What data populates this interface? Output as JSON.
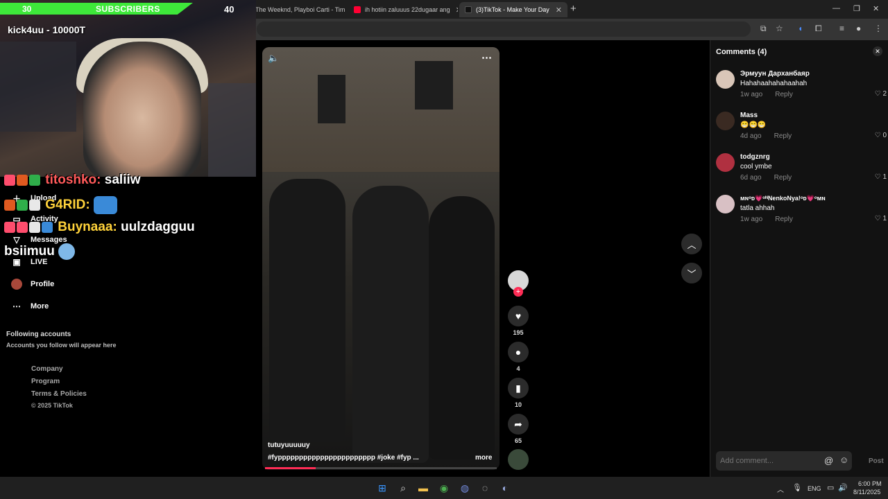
{
  "browser": {
    "tabs": [
      {
        "label": "The Weeknd, Playboi Carti - Tim",
        "fav_color": "#ff0033"
      },
      {
        "label": "ih hotiin zaluuus 22dugaar ang",
        "fav_color": "#ff0033"
      },
      {
        "label": "(3)TikTok - Make Your Day",
        "fav_color": "#111111"
      }
    ],
    "new_tab": "+"
  },
  "stream": {
    "sub_current": "30",
    "sub_label": "SUBSCRIBERS",
    "sub_goal": "40",
    "streamer_text": "kick4uu - 10000T"
  },
  "chat": [
    {
      "user": "titoshko:",
      "message": "saliiw",
      "user_color": "#ff5a5a"
    },
    {
      "user": "G4RID:",
      "message": "",
      "user_color": "#ffd23a"
    },
    {
      "user": "Buynaaa:",
      "message": "uulzdagguu",
      "user_color": "#ffd23a"
    },
    {
      "user": "",
      "message": "bsiimuu",
      "user_color": "#ffffff"
    }
  ],
  "sidebar": {
    "items": [
      {
        "label": "Upload",
        "icon": "plus-icon"
      },
      {
        "label": "Activity",
        "icon": "inbox-icon"
      },
      {
        "label": "Messages",
        "icon": "send-icon"
      },
      {
        "label": "LIVE",
        "icon": "live-icon"
      },
      {
        "label": "Profile",
        "icon": "avatar-icon"
      },
      {
        "label": "More",
        "icon": "more-icon"
      }
    ],
    "following_title": "Following accounts",
    "following_hint": "Accounts you follow will appear here",
    "footer": [
      "Company",
      "Program",
      "Terms & Policies",
      "© 2025 TikTok"
    ]
  },
  "video": {
    "author": "tutuyuuuuuy",
    "caption": "#fyppppppppppppppppppppppp  #joke  #fyp  ...",
    "more_label": "more",
    "progress": 0.22
  },
  "actions": {
    "likes": "195",
    "comments": "4",
    "saves": "10",
    "shares": "65"
  },
  "comments": {
    "title": "Comments (4)",
    "items": [
      {
        "user": "Эрмуун Дарханбаяр",
        "text": "Hahahaahahahaahah",
        "time": "1w ago",
        "reply": "Reply",
        "likes": "2",
        "av": "#d9c6b8"
      },
      {
        "user": "Mass",
        "text": "😁😁😁",
        "time": "4d ago",
        "reply": "Reply",
        "likes": "0",
        "av": "#3a2a22"
      },
      {
        "user": "todgznrg",
        "text": "cool ymbe",
        "time": "6d ago",
        "reply": "Reply",
        "likes": "1",
        "av": "#b03040"
      },
      {
        "user": "ᴍɴᵒᴅ💗ᵒᴺNenkoNya!ᵒᴅ💗ᵒᴍɴ",
        "text": "tatla ahhah",
        "time": "1w ago",
        "reply": "Reply",
        "likes": "1",
        "av": "#d8c0c4"
      }
    ],
    "placeholder": "Add comment...",
    "post": "Post"
  },
  "taskbar": {
    "lang": "ENG",
    "time": "6:00 PM",
    "date": "8/11/2025"
  },
  "colors": {
    "accent": "#fe2c55",
    "sub_bar": "#3ee83a"
  }
}
